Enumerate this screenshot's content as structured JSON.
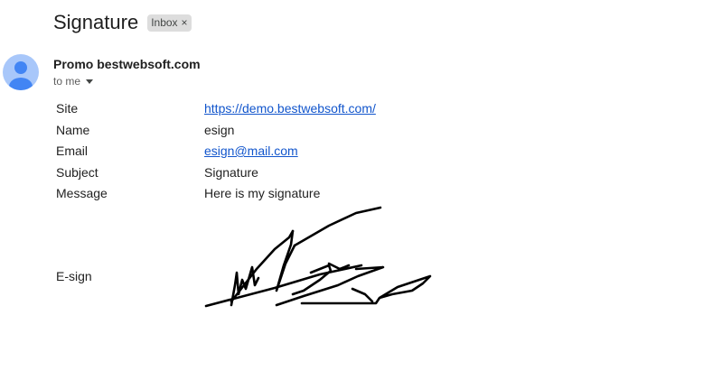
{
  "email": {
    "subject": "Signature",
    "label_chip": "Inbox",
    "label_chip_remove": "×",
    "sender": "Promo bestwebsoft.com",
    "recipient_text": "to me"
  },
  "fields": [
    {
      "label": "Site",
      "value": "https://demo.bestwebsoft.com/",
      "is_link": true
    },
    {
      "label": "Name",
      "value": "esign",
      "is_link": false
    },
    {
      "label": "Email",
      "value": "esign@mail.com",
      "is_link": true
    },
    {
      "label": "Subject",
      "value": "Signature",
      "is_link": false
    },
    {
      "label": "Message",
      "value": "Here is my signature",
      "is_link": false
    },
    {
      "label": "E-sign",
      "value": "",
      "is_link": false
    }
  ],
  "icons": {
    "avatar": "default-user-avatar",
    "caret": "caret-down-icon",
    "chip_remove": "close-icon"
  },
  "colors": {
    "link": "#1155cc",
    "avatar_bg": "#a8c7fa",
    "avatar_fg": "#4285f4",
    "chip_bg": "#dddddd"
  }
}
